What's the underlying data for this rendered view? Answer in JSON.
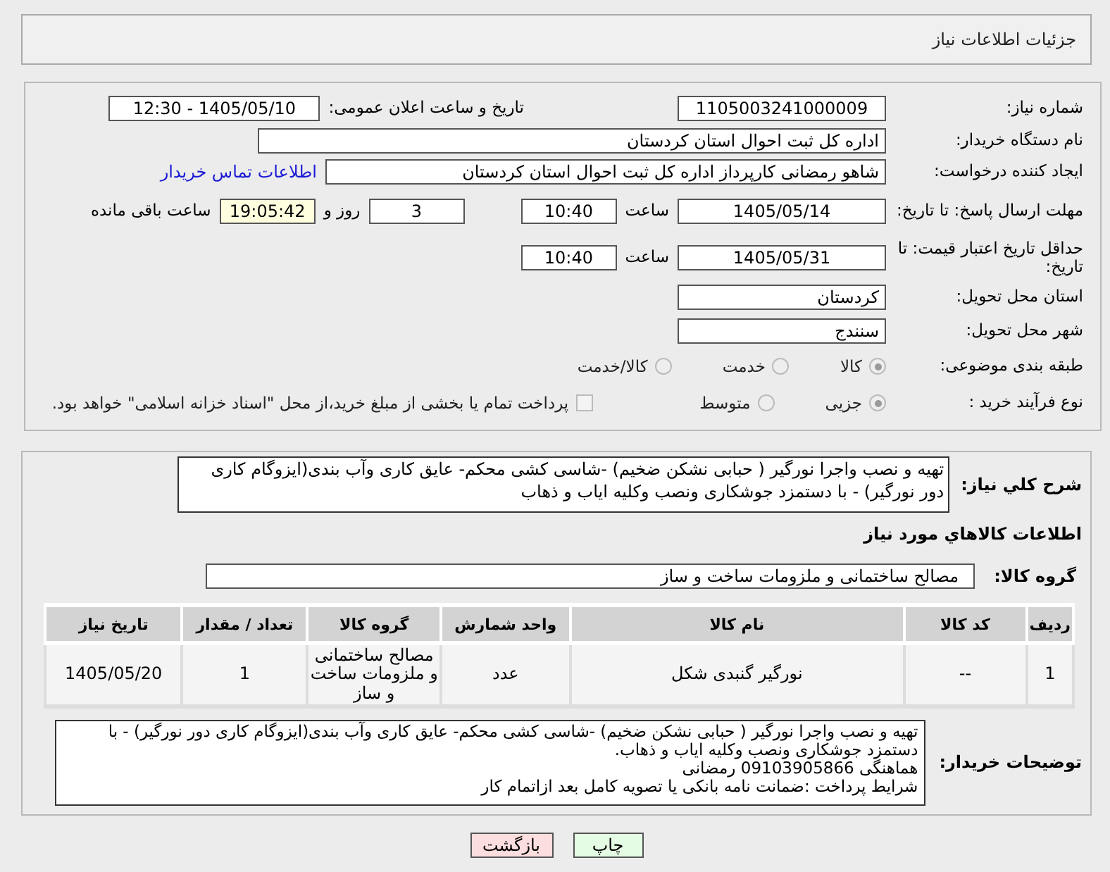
{
  "header": {
    "title": "جزئیات اطلاعات نیاز"
  },
  "need_number": {
    "label": "شماره نیاز:",
    "value": "1105003241000009"
  },
  "announce": {
    "label": "تاریخ و ساعت اعلان عمومی:",
    "value": "1405/05/10 - 12:30"
  },
  "buyer_org": {
    "label": "نام دستگاه خریدار:",
    "value": "اداره کل ثبت احوال استان کردستان"
  },
  "requester": {
    "label": "ایجاد کننده درخواست:",
    "value": "شاهو رمضانی کارپرداز اداره کل ثبت احوال استان کردستان",
    "link": "اطلاعات تماس خریدار"
  },
  "deadline": {
    "label": "مهلت ارسال پاسخ: تا تاریخ:",
    "date": "1405/05/14",
    "time_label": "ساعت",
    "time": "10:40",
    "days": "3",
    "days_label": "روز و",
    "remaining": "19:05:42",
    "remaining_label": "ساعت باقی مانده"
  },
  "price_validity": {
    "label": "حداقل تاریخ اعتبار قیمت: تا تاریخ:",
    "date": "1405/05/31",
    "time_label": "ساعت",
    "time": "10:40"
  },
  "province": {
    "label": "استان محل تحویل:",
    "value": "کردستان"
  },
  "city": {
    "label": "شهر محل تحویل:",
    "value": "سنندج"
  },
  "category": {
    "label": "طبقه بندی موضوعی:",
    "options": [
      {
        "label": "کالا",
        "selected": true
      },
      {
        "label": "خدمت",
        "selected": false
      },
      {
        "label": "کالا/خدمت",
        "selected": false
      }
    ]
  },
  "process": {
    "label": "نوع فرآیند خرید :",
    "options": [
      {
        "label": "جزیی",
        "selected": true
      },
      {
        "label": "متوسط",
        "selected": false
      }
    ],
    "payment": {
      "label": "پرداخت تمام یا بخشی از مبلغ خرید،از محل \"اسناد خزانه اسلامی\" خواهد بود.",
      "checked": false
    }
  },
  "description": {
    "label": "شرح کلي نياز:",
    "text": "تهیه و نصب واجرا نورگیر ( حبابی نشکن ضخیم) -شاسی کشی محکم- عایق کاری وآب بندی(ایزوگام کاری دور نورگیر) - با دستمزد جوشکاری ونصب وکلیه ایاب و ذهاب"
  },
  "goods_title": "اطلاعات کالاهاي مورد نياز",
  "goods_group": {
    "label": "گروه کالا:",
    "value": "مصالح ساختمانی و ملزومات ساخت و ساز"
  },
  "table": {
    "columns": [
      "ردیف",
      "کد کالا",
      "نام کالا",
      "واحد شمارش",
      "گروه کالا",
      "تعداد / مقدار",
      "تاریخ نیاز"
    ],
    "rows": [
      [
        "1",
        "--",
        "نورگیر گنبدی شکل",
        "عدد",
        "مصالح ساختمانی و ملزومات ساخت و ساز",
        "1",
        "1405/05/20"
      ]
    ]
  },
  "buyer_notes": {
    "label": "توضیحات خریدار:",
    "lines": [
      "تهیه و نصب واجرا نورگیر ( حبابی نشکن ضخیم) -شاسی کشی محکم- عایق کاری وآب بندی(ایزوگام کاری دور نورگیر) - با دستمزد جوشکاری ونصب وکلیه ایاب و ذهاب.",
      "هماهنگی 09103905866 رمضانی",
      "شرایط پرداخت :ضمانت نامه بانکی یا تصویه کامل بعد ازاتمام کار"
    ]
  },
  "buttons": [
    {
      "label": "چاپ",
      "kind": "print"
    },
    {
      "label": "بازگشت",
      "kind": "back"
    }
  ]
}
